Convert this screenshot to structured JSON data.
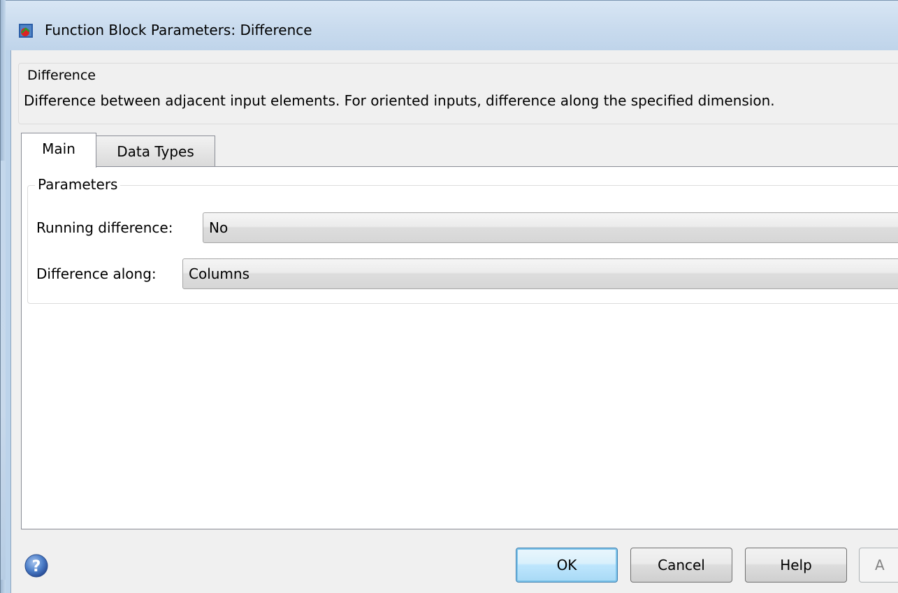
{
  "window": {
    "title": "Function Block Parameters: Difference"
  },
  "description": {
    "group_title": "Difference",
    "text": "Difference between adjacent input elements.  For oriented inputs, difference along the specified dimension."
  },
  "tabs": [
    {
      "label": "Main",
      "active": true
    },
    {
      "label": "Data Types",
      "active": false
    }
  ],
  "parameters": {
    "group_title": "Parameters",
    "running_difference": {
      "label": "Running difference:",
      "value": "No"
    },
    "difference_along": {
      "label": "Difference along:",
      "value": "Columns"
    }
  },
  "buttons": {
    "ok": "OK",
    "cancel": "Cancel",
    "help": "Help",
    "apply": "A"
  },
  "icons": {
    "window": "simulink-block-icon",
    "help": "question-circle-icon"
  },
  "colors": {
    "titlebar": "#c9dbee",
    "client_bg": "#f0f0f0",
    "panel_bg": "#ffffff",
    "default_button_border": "#3c7fb1"
  }
}
